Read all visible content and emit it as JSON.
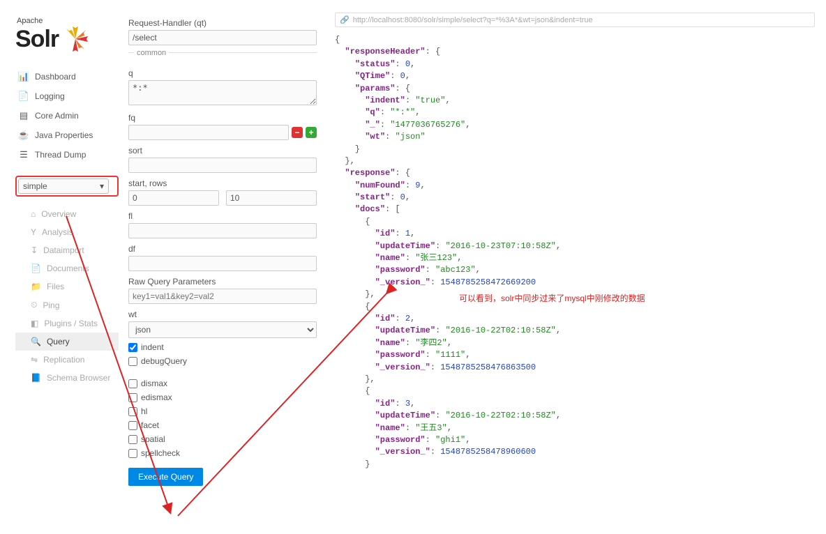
{
  "app": {
    "name_line1": "Apache",
    "name_line2": "Solr"
  },
  "nav": {
    "items": [
      {
        "label": "Dashboard",
        "icon": "🏁"
      },
      {
        "label": "Logging",
        "icon": "📄"
      },
      {
        "label": "Core Admin",
        "icon": "≣"
      },
      {
        "label": "Java Properties",
        "icon": "☕"
      },
      {
        "label": "Thread Dump",
        "icon": "⧉"
      }
    ]
  },
  "core_selector": {
    "selected": "simple"
  },
  "sub_nav": {
    "items": [
      {
        "label": "Overview",
        "icon": "⌂"
      },
      {
        "label": "Analysis",
        "icon": "Y"
      },
      {
        "label": "Dataimport",
        "icon": "↧"
      },
      {
        "label": "Documents",
        "icon": "📄"
      },
      {
        "label": "Files",
        "icon": "📁"
      },
      {
        "label": "Ping",
        "icon": "⏲"
      },
      {
        "label": "Plugins / Stats",
        "icon": "■"
      },
      {
        "label": "Query",
        "icon": "🔍",
        "active": true
      },
      {
        "label": "Replication",
        "icon": "⇋"
      },
      {
        "label": "Schema Browser",
        "icon": "📘"
      }
    ]
  },
  "form": {
    "qt_label": "Request-Handler (qt)",
    "qt_value": "/select",
    "common_label": "common",
    "q_label": "q",
    "q_value": "*:*",
    "fq_label": "fq",
    "fq_value": "",
    "sort_label": "sort",
    "sort_value": "",
    "startrows_label": "start, rows",
    "start_value": "0",
    "rows_value": "10",
    "fl_label": "fl",
    "fl_value": "",
    "df_label": "df",
    "df_value": "",
    "raw_label": "Raw Query Parameters",
    "raw_placeholder": "key1=val1&key2=val2",
    "wt_label": "wt",
    "wt_value": "json",
    "indent_label": "indent",
    "debug_label": "debugQuery",
    "dismax_label": "dismax",
    "edismax_label": "edismax",
    "hl_label": "hl",
    "facet_label": "facet",
    "spatial_label": "spatial",
    "spellcheck_label": "spellcheck",
    "execute_label": "Execute Query"
  },
  "result": {
    "url": "http://localhost:8080/solr/simple/select?q=*%3A*&wt=json&indent=true",
    "annotation": "可以看到，solr中同步过来了mysql中刚修改的数据",
    "json": {
      "responseHeader": {
        "status": 0,
        "QTime": 0,
        "params": {
          "indent": "true",
          "q": "*:*",
          "_": "1477036765276",
          "wt": "json"
        }
      },
      "response": {
        "numFound": 9,
        "start": 0,
        "docs": [
          {
            "id": 1,
            "updateTime": "2016-10-23T07:10:58Z",
            "name": "张三123",
            "password": "abc123",
            "_version_": 1548785258472669200
          },
          {
            "id": 2,
            "updateTime": "2016-10-22T02:10:58Z",
            "name": "李四2",
            "password": "1111",
            "_version_": 1548785258476863500
          },
          {
            "id": 3,
            "updateTime": "2016-10-22T02:10:58Z",
            "name": "王五3",
            "password": "ghi1",
            "_version_": 1548785258478960600
          }
        ]
      }
    }
  }
}
